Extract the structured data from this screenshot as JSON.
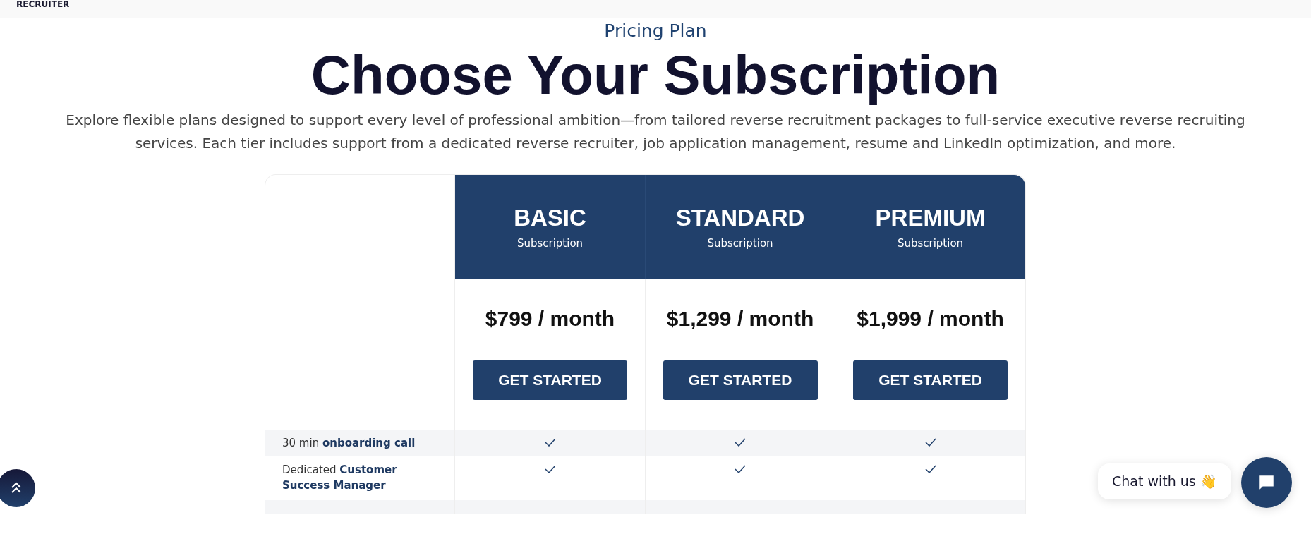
{
  "top_bar": {
    "brand": "RECRUITER"
  },
  "eyebrow": "Pricing Plan",
  "heading": "Choose Your Subscription",
  "intro": "Explore flexible plans designed to support every level of professional ambition—from tailored reverse recruitment packages to full-service executive reverse recruiting services. Each tier includes support from a dedicated reverse recruiter, job application management, resume and LinkedIn optimization, and more.",
  "plans": [
    {
      "name": "BASIC",
      "subtitle": "Subscription",
      "price": "$799 / month",
      "button": "GET STARTED"
    },
    {
      "name": "STANDARD",
      "subtitle": "Subscription",
      "price": "$1,299 / month",
      "button": "GET STARTED"
    },
    {
      "name": "PREMIUM",
      "subtitle": "Subscription",
      "price": "$1,999 / month",
      "button": "GET STARTED"
    }
  ],
  "features": [
    {
      "label": "30 min **onboarding call**",
      "included": [
        true,
        true,
        true
      ]
    },
    {
      "label": "Dedicated **Customer Success Manager**",
      "included": [
        true,
        true,
        true
      ]
    }
  ],
  "chat": {
    "label": "Chat with us 👋"
  }
}
